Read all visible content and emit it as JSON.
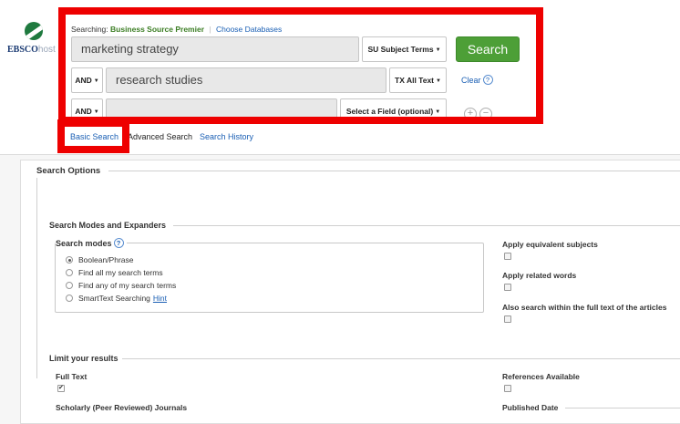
{
  "brand": {
    "logo_main": "EBSCO",
    "logo_sub": "host"
  },
  "search": {
    "searching_prefix": "Searching:",
    "database": "Business Source Premier",
    "separator": "|",
    "choose_databases": "Choose Databases",
    "rows": [
      {
        "operator": "",
        "value": "marketing strategy",
        "field": "SU Subject Terms"
      },
      {
        "operator": "AND",
        "value": "research studies",
        "field": "TX All Text"
      },
      {
        "operator": "AND",
        "value": "",
        "field": "Select a Field (optional)"
      }
    ],
    "search_button": "Search",
    "clear_label": "Clear",
    "help_glyph": "?",
    "add_glyph": "+",
    "remove_glyph": "−",
    "caret_glyph": "▼"
  },
  "tabs": {
    "basic": "Basic Search",
    "advanced": "Advanced Search",
    "history": "Search History"
  },
  "options": {
    "title": "Search Options",
    "modes_section": "Search Modes and Expanders",
    "modes_label": "Search modes",
    "modes": [
      {
        "label": "Boolean/Phrase",
        "selected": true
      },
      {
        "label": "Find all my search terms",
        "selected": false
      },
      {
        "label": "Find any of my search terms",
        "selected": false
      },
      {
        "label": "SmartText Searching",
        "selected": false
      }
    ],
    "hint_label": "Hint",
    "expanders": [
      {
        "label": "Apply equivalent subjects",
        "checked": false
      },
      {
        "label": "Apply related words",
        "checked": false
      },
      {
        "label": "Also search within the full text of the articles",
        "checked": false
      }
    ],
    "limit_section": "Limit your results",
    "limits_left": [
      {
        "label": "Full Text",
        "checked": true
      },
      {
        "label": "Scholarly (Peer Reviewed) Journals",
        "checked": false
      }
    ],
    "limits_right": [
      {
        "label": "References Available",
        "checked": false
      },
      {
        "label": "Published Date"
      }
    ]
  },
  "colors": {
    "highlight": "#ee0000",
    "search_button": "#4d9f37",
    "link": "#1a5fb4",
    "database": "#3b7d23"
  }
}
